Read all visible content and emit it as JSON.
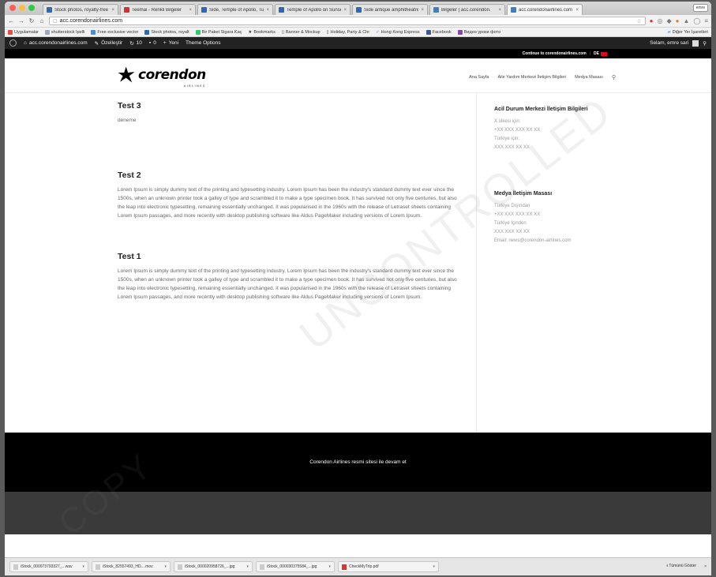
{
  "browser": {
    "tabs": [
      {
        "label": "Stock photos, royalty-free",
        "favicon": "#2a6ab5"
      },
      {
        "label": "Teemai - Renkli Bilgeler",
        "favicon": "#d32f2f"
      },
      {
        "label": "Side, Temple of Apollo, Tu",
        "favicon": "#2a6ab5"
      },
      {
        "label": "Temple of Apollo on Sunset",
        "favicon": "#2a6ab5"
      },
      {
        "label": "Side antique amphitheatre",
        "favicon": "#2a6ab5"
      },
      {
        "label": "Bilgeler | acc.corendon.",
        "favicon": "#3b82c4"
      },
      {
        "label": "acc.corendonairlines.com",
        "favicon": "#3b82c4"
      }
    ],
    "profile": "emre",
    "url": "acc.corendonairlines.com",
    "bookmarks": [
      "Uygulamalar",
      "shutterstock Ipelli",
      "Free exclusive vector",
      "Stock photos, royalt",
      "Bir Paket Sigara Kaç",
      "Bookmarks",
      "Banner & Mockup",
      "Holiday, Party & Chr",
      "Hong Kong Express",
      "Facebook",
      "Видео уроки фото"
    ],
    "bookmarks_other": "Diğer Yer İşaretleri"
  },
  "adminbar": {
    "site": "acc.corendonairlines.com",
    "customize": "Özelleştir",
    "updates": "10",
    "comments": "0",
    "new": "Yeni",
    "theme_options": "Theme Options",
    "greeting": "Selam, emre sari"
  },
  "site": {
    "topstrip_link": "Continue to corendonairlines.com",
    "lang": "DE",
    "logo_text": "corendon",
    "logo_sub": "AIRLINES",
    "nav": [
      "Ana Sayfa",
      "Aile Yardım Merkezi İletişim Bilgileri",
      "Medya Masası"
    ],
    "posts": [
      {
        "title": "Test 3",
        "body": "deneme"
      },
      {
        "title": "Test 2",
        "body": "Lorem Ipsum is simply dummy text of the printing and typesetting industry. Lorem Ipsum has been the industry's standard dummy text ever since the 1500s, when an unknown printer took a galley of type and scrambled it to make a type specimen book. It has survived not only five centuries, but also the leap into electronic typesetting, remaining essentially unchanged. It was popularised in the 1960s with the release of Letraset sheets containing Lorem Ipsum passages, and more recently with desktop publishing software like Aldus PageMaker including versions of Lorem Ipsum."
      },
      {
        "title": "Test 1",
        "body": "Lorem Ipsum is simply dummy text of the printing and typesetting industry. Lorem Ipsum has been the industry's standard dummy text ever since the 1500s, when an unknown printer took a galley of type and scrambled it to make a type specimen book. It has survived not only five centuries, but also the leap into electronic typesetting, remaining essentially unchanged. It was popularised in the 1960s with the release of Letraset sheets containing Lorem Ipsum passages, and more recently with desktop publishing software like Aldus PageMaker including versions of Lorem Ipsum."
      }
    ],
    "sidebar": [
      {
        "title": "Acil Durum Merkezi İletişim Bilgileri",
        "lines": [
          "X ülkesi için:",
          "+XX XXX XXX XX XX",
          "Türkiye için:",
          "XXX XXX XX XX"
        ]
      },
      {
        "title": "Medya İletişim Masası",
        "lines": [
          "Türkiye Dışından",
          "+XX XXX XXX XX XX",
          "Türkiye İçinden",
          "XXX XXX XX XX",
          "Email: news@corendon-airlines.com"
        ]
      }
    ],
    "footer_text": "Corendon Airlines resmi sitesi ile devam et"
  },
  "downloads": {
    "items": [
      {
        "name": "iStock_000073793327_...wav"
      },
      {
        "name": "iStock_82557493_HD....mov"
      },
      {
        "name": "iStock_000020958726_...jpg"
      },
      {
        "name": "iStock_000030375584_...jpg"
      },
      {
        "name": "CheckMyTrip.pdf"
      }
    ],
    "show_all": "Tümünü Göster"
  },
  "watermarks": [
    "UNCONTROLLED",
    "COPY"
  ],
  "colors": {
    "admin_bar": "#222222",
    "site_black": "#000000",
    "flag_red": "#e30a17",
    "footer_dark": "#3a3a3a"
  }
}
